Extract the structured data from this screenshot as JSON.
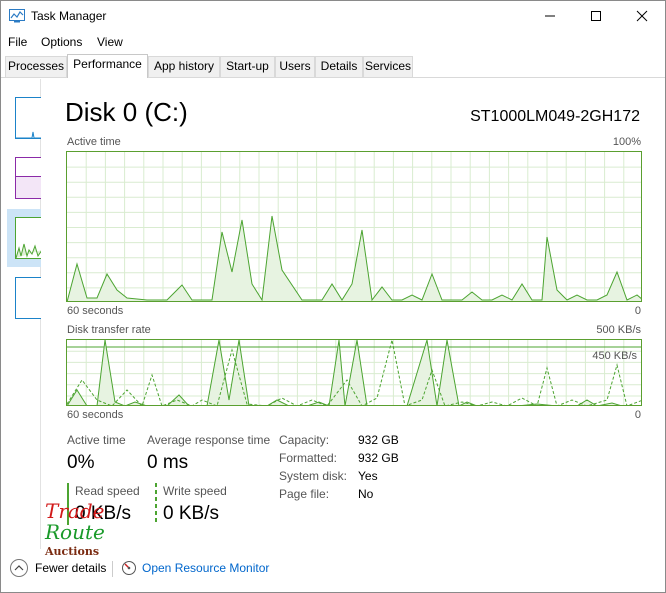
{
  "window": {
    "title": "Task Manager"
  },
  "menu": {
    "file": "File",
    "options": "Options",
    "view": "View"
  },
  "tabs": [
    "Processes",
    "Performance",
    "App history",
    "Start-up",
    "Users",
    "Details",
    "Services"
  ],
  "disk": {
    "name": "Disk 0 (C:)",
    "model": "ST1000LM049-2GH172",
    "active_time_graph": {
      "label": "Active time",
      "max_label": "100%",
      "time_label": "60 seconds",
      "min_label": "0"
    },
    "transfer_graph": {
      "label": "Disk transfer rate",
      "max_label": "500 KB/s",
      "line_label": "450 KB/s",
      "time_label": "60 seconds",
      "min_label": "0"
    }
  },
  "stats": {
    "active_time": {
      "label": "Active time",
      "value": "0%"
    },
    "response_time": {
      "label": "Average response time",
      "value": "0 ms"
    },
    "read_speed": {
      "label": "Read speed",
      "value": "0 KB/s"
    },
    "write_speed": {
      "label": "Write speed",
      "value": "0 KB/s"
    }
  },
  "details": {
    "capacity": {
      "label": "Capacity:",
      "value": "932 GB"
    },
    "formatted": {
      "label": "Formatted:",
      "value": "932 GB"
    },
    "system_disk": {
      "label": "System disk:",
      "value": "Yes"
    },
    "page_file": {
      "label": "Page file:",
      "value": "No"
    }
  },
  "watermark": {
    "line1": "Trade",
    "line2": "Route",
    "line3": "Auctions"
  },
  "footer": {
    "fewer_details": "Fewer details",
    "resource_monitor": "Open Resource Monitor"
  },
  "colors": {
    "disk_green": "#4ca431",
    "grid": "#d9ecd0",
    "link": "#0066cc",
    "selected": "#cce4f7"
  }
}
